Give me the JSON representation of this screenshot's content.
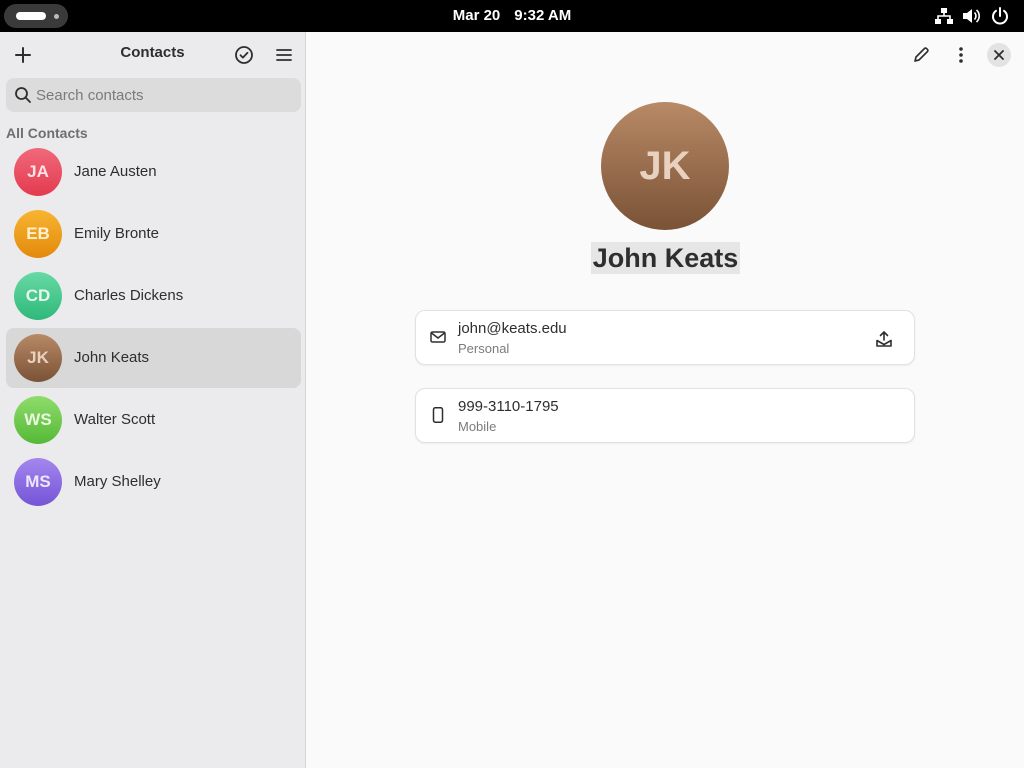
{
  "topbar": {
    "date": "Mar 20",
    "time": "9:32 AM",
    "icons": [
      "network-icon",
      "volume-icon",
      "power-icon"
    ]
  },
  "sidebar": {
    "title": "Contacts",
    "search_placeholder": "Search contacts",
    "section_label": "All Contacts",
    "contacts": [
      {
        "initials": "JA",
        "name": "Jane Austen",
        "avatar_top": "#f06a7a",
        "avatar_bottom": "#e43a4f",
        "text_color": "#fde3e6",
        "selected": false
      },
      {
        "initials": "EB",
        "name": "Emily Bronte",
        "avatar_top": "#f7b532",
        "avatar_bottom": "#e3890b",
        "text_color": "#fff1cf",
        "selected": false
      },
      {
        "initials": "CD",
        "name": "Charles Dickens",
        "avatar_top": "#68d9a4",
        "avatar_bottom": "#2fb97a",
        "text_color": "#e3f8ee",
        "selected": false
      },
      {
        "initials": "JK",
        "name": "John Keats",
        "avatar_top": "#b88a66",
        "avatar_bottom": "#7a5236",
        "text_color": "#e8d2bf",
        "selected": true
      },
      {
        "initials": "WS",
        "name": "Walter Scott",
        "avatar_top": "#8fdc6c",
        "avatar_bottom": "#55b936",
        "text_color": "#eaf9e1",
        "selected": false
      },
      {
        "initials": "MS",
        "name": "Mary Shelley",
        "avatar_top": "#a487ee",
        "avatar_bottom": "#7554d6",
        "text_color": "#ece6fb",
        "selected": false
      }
    ]
  },
  "main": {
    "initials": "JK",
    "name": "John Keats",
    "details": [
      {
        "icon": "mail-icon",
        "value": "john@keats.edu",
        "label": "Personal",
        "action_icon": "send-icon"
      },
      {
        "icon": "phone-icon",
        "value": "999-3110-1795",
        "label": "Mobile"
      }
    ]
  },
  "colors": {
    "sidebar_bg": "#ebebed",
    "selected_row": "#d8d8d9",
    "main_bg": "#fafafa"
  }
}
